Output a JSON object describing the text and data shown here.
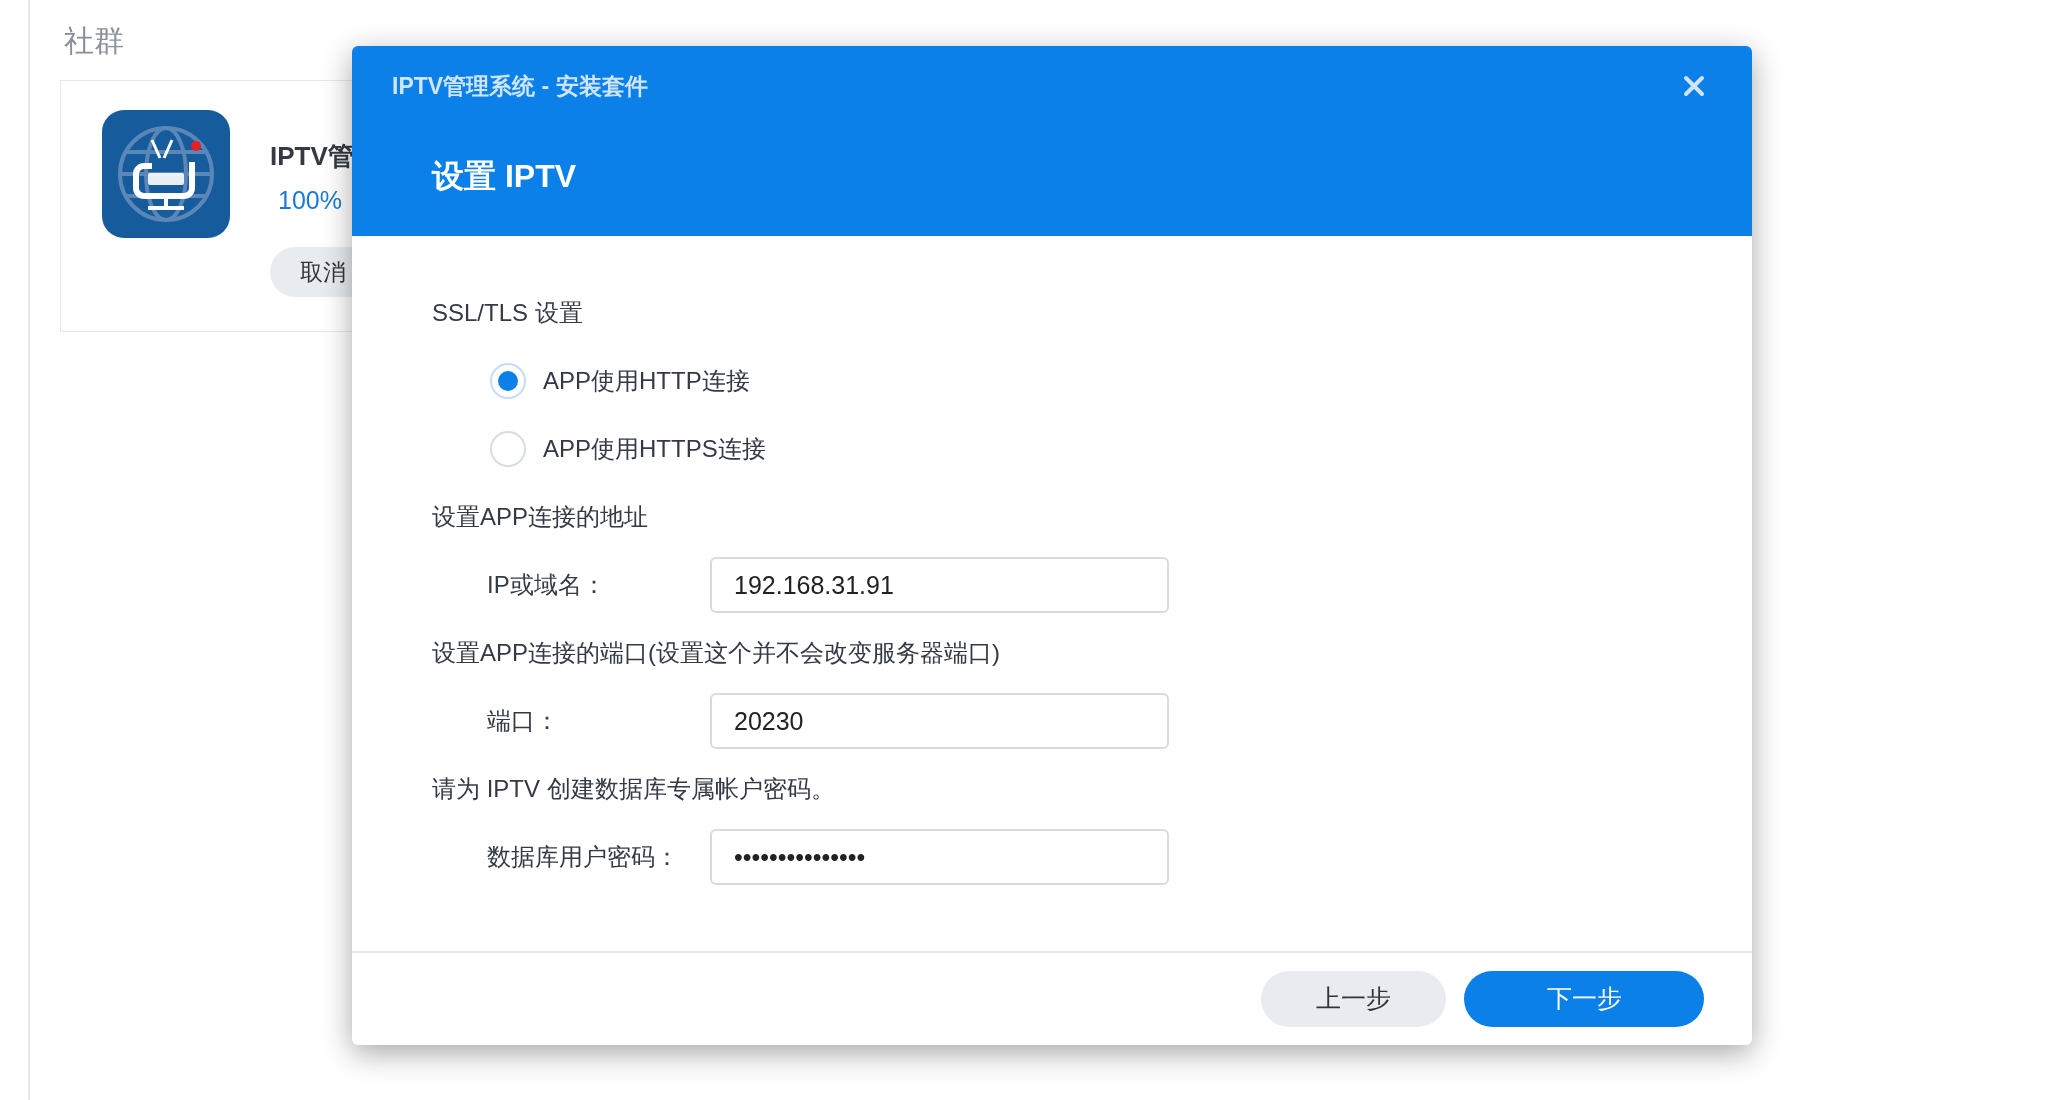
{
  "background": {
    "section_title": "社群",
    "package": {
      "name": "IPTV管",
      "progress": "100%",
      "cancel_button": "取消"
    }
  },
  "dialog": {
    "title": "IPTV管理系统 - 安装套件",
    "heading": "设置 IPTV",
    "form": [
      {
        "kind": "heading",
        "text": "SSL/TLS 设置"
      },
      {
        "kind": "radio",
        "label": "APP使用HTTP连接",
        "selected": true
      },
      {
        "kind": "radio",
        "label": "APP使用HTTPS连接",
        "selected": false
      },
      {
        "kind": "heading",
        "text": "设置APP连接的地址"
      },
      {
        "kind": "field",
        "label": "IP或域名：",
        "value": "192.168.31.91"
      },
      {
        "kind": "heading",
        "text": "设置APP连接的端口(设置这个并不会改变服务器端口)"
      },
      {
        "kind": "field",
        "label": "端口：",
        "value": "20230"
      },
      {
        "kind": "heading",
        "text": "请为 IPTV 创建数据库专属帐户密码。"
      },
      {
        "kind": "field",
        "label": "数据库用户密码：",
        "value": "•••••••••••••••"
      }
    ],
    "buttons": [
      {
        "label": "上一步",
        "kind": "secondary"
      },
      {
        "label": "下一步",
        "kind": "primary"
      }
    ]
  }
}
